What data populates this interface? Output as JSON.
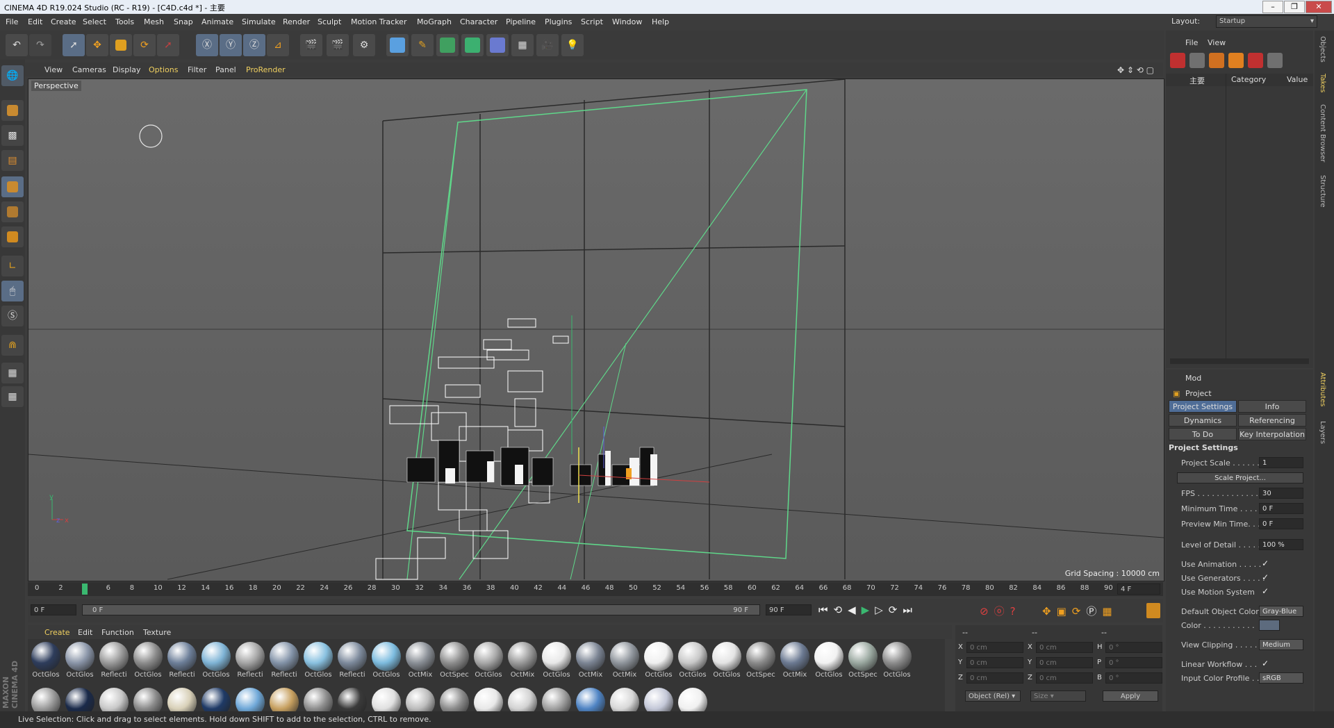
{
  "window": {
    "title": "CINEMA 4D R19.024 Studio (RC - R19) - [C4D.c4d *] - 主要",
    "layout_label": "Layout:",
    "layout_value": "Startup"
  },
  "menubar": [
    "File",
    "Edit",
    "Create",
    "Select",
    "Tools",
    "Mesh",
    "Snap",
    "Animate",
    "Simulate",
    "Render",
    "Sculpt",
    "Motion Tracker",
    "MoGraph",
    "Character",
    "Pipeline",
    "Plugins",
    "Script",
    "Window",
    "Help"
  ],
  "viewport": {
    "menu": [
      "View",
      "Cameras",
      "Display",
      "Options",
      "Filter",
      "Panel",
      "ProRender"
    ],
    "label": "Perspective",
    "grid_spacing": "Grid Spacing : 10000 cm",
    "axis_y": "y",
    "axis_z": "z",
    "axis_x": "x"
  },
  "timeline": {
    "ticks": [
      "0",
      "2",
      "4",
      "6",
      "8",
      "10",
      "12",
      "14",
      "16",
      "18",
      "20",
      "22",
      "24",
      "26",
      "28",
      "30",
      "32",
      "34",
      "36",
      "38",
      "40",
      "42",
      "44",
      "46",
      "48",
      "50",
      "52",
      "54",
      "56",
      "58",
      "60",
      "62",
      "64",
      "66",
      "68",
      "70",
      "72",
      "74",
      "76",
      "78",
      "80",
      "82",
      "84",
      "86",
      "88",
      "90"
    ],
    "current_frame": "4 F",
    "start_field": "0 F",
    "range_start": "0 F",
    "range_end": "90 F",
    "end_field": "90 F"
  },
  "materials": {
    "menu": [
      "Create",
      "Edit",
      "Function",
      "Texture"
    ],
    "row1": [
      {
        "label": "OctGlos",
        "color": "#2e3d5c"
      },
      {
        "label": "OctGlos",
        "color": "#8a95a8"
      },
      {
        "label": "Reflecti",
        "color": "#9a9a9a"
      },
      {
        "label": "OctGlos",
        "color": "#8c8c8c"
      },
      {
        "label": "Reflecti",
        "color": "#6d7f99"
      },
      {
        "label": "OctGlos",
        "color": "#7fb4d6"
      },
      {
        "label": "Reflecti",
        "color": "#a5a5a5"
      },
      {
        "label": "Reflecti",
        "color": "#8393a8"
      },
      {
        "label": "OctGlos",
        "color": "#89c1e0"
      },
      {
        "label": "Reflecti",
        "color": "#7d8a9c"
      },
      {
        "label": "OctGlos",
        "color": "#7dbcdf"
      },
      {
        "label": "OctMix",
        "color": "#8a8f96"
      },
      {
        "label": "OctSpec",
        "color": "#8e8e8e"
      },
      {
        "label": "OctGlos",
        "color": "#a8a8a8"
      },
      {
        "label": "OctMix",
        "color": "#9a9a9a"
      },
      {
        "label": "OctGlos",
        "color": "#e8e8e8"
      },
      {
        "label": "OctMix",
        "color": "#7c8594"
      },
      {
        "label": "OctMix",
        "color": "#8f959c"
      },
      {
        "label": "OctGlos",
        "color": "#f0f0f0"
      },
      {
        "label": "OctGlos",
        "color": "#c8c8c8"
      },
      {
        "label": "OctGlos",
        "color": "#e4e4e4"
      },
      {
        "label": "OctSpec",
        "color": "#8a8a8a"
      },
      {
        "label": "OctMix",
        "color": "#6c7a92"
      },
      {
        "label": "OctGlos",
        "color": "#f2f2f2"
      },
      {
        "label": "OctSpec",
        "color": "#9aa8a0"
      },
      {
        "label": "OctGlos",
        "color": "#8c8c8c"
      }
    ],
    "row2_colors": [
      "#9a9a9a",
      "#1a2a4a",
      "#c8c8c8",
      "#8a8a8a",
      "#d8d0b8",
      "#1f3a66",
      "#6fa8d8",
      "#c7a060",
      "#8e8e8e",
      "#3a3a3a",
      "#e0e0e0",
      "#bcbcbc",
      "#8c8c8c",
      "#e8e8e8",
      "#d2d2d2",
      "#a0a0a0",
      "#4f84c4",
      "#d8d8d8",
      "#c4c8d8",
      "#f0f0f0"
    ]
  },
  "coordinates": {
    "headers": [
      "--",
      "--",
      "--"
    ],
    "rows": [
      {
        "a": "X",
        "av": "0 cm",
        "b": "X",
        "bv": "0 cm",
        "c": "H",
        "cv": "0 °"
      },
      {
        "a": "Y",
        "av": "0 cm",
        "b": "Y",
        "bv": "0 cm",
        "c": "P",
        "cv": "0 °"
      },
      {
        "a": "Z",
        "av": "0 cm",
        "b": "Z",
        "bv": "0 cm",
        "c": "B",
        "cv": "0 °"
      }
    ],
    "mode": "Object (Rel)",
    "size": "Size",
    "apply": "Apply"
  },
  "objects": {
    "menu": [
      "File",
      "View"
    ],
    "root": "主要",
    "col_category": "Category",
    "col_value": "Value"
  },
  "attributes": {
    "mode": "Mod",
    "object": "Project",
    "tabs": [
      "Project Settings",
      "Info",
      "Dynamics",
      "Referencing",
      "To Do",
      "Key Interpolation"
    ],
    "section": "Project Settings",
    "rows": [
      {
        "label": "Project Scale . . . . . .",
        "value": "1"
      },
      {
        "label": "FPS . . . . . . . . . . . . . .",
        "value": "30"
      },
      {
        "label": "Minimum Time . . . . .",
        "value": "0 F"
      },
      {
        "label": "Preview Min Time. . .",
        "value": "0 F"
      },
      {
        "label": "Level of Detail . . . . .",
        "value": "100 %"
      }
    ],
    "scale_button": "Scale Project...",
    "checks": [
      "Use Animation . . . . .",
      "Use Generators . . . . .",
      "Use Motion System"
    ],
    "default_color_label": "Default Object Color",
    "default_color_value": "Gray-Blue",
    "color_label": "Color . . . . . . . . . . .",
    "view_clipping_label": "View Clipping . . . . . .",
    "view_clipping_value": "Medium",
    "linear_workflow": "Linear Workflow . . .",
    "input_profile_label": "Input Color Profile . . .",
    "input_profile_value": "sRGB",
    "check_mark": "✓"
  },
  "side_tabs": [
    "Objects",
    "Takes",
    "Content Browser",
    "Structure",
    "Attributes",
    "Layers"
  ],
  "status": "Live Selection: Click and drag to select elements. Hold down SHIFT to add to the selection, CTRL to remove.",
  "brand": "MAXON CINEMA 4D"
}
